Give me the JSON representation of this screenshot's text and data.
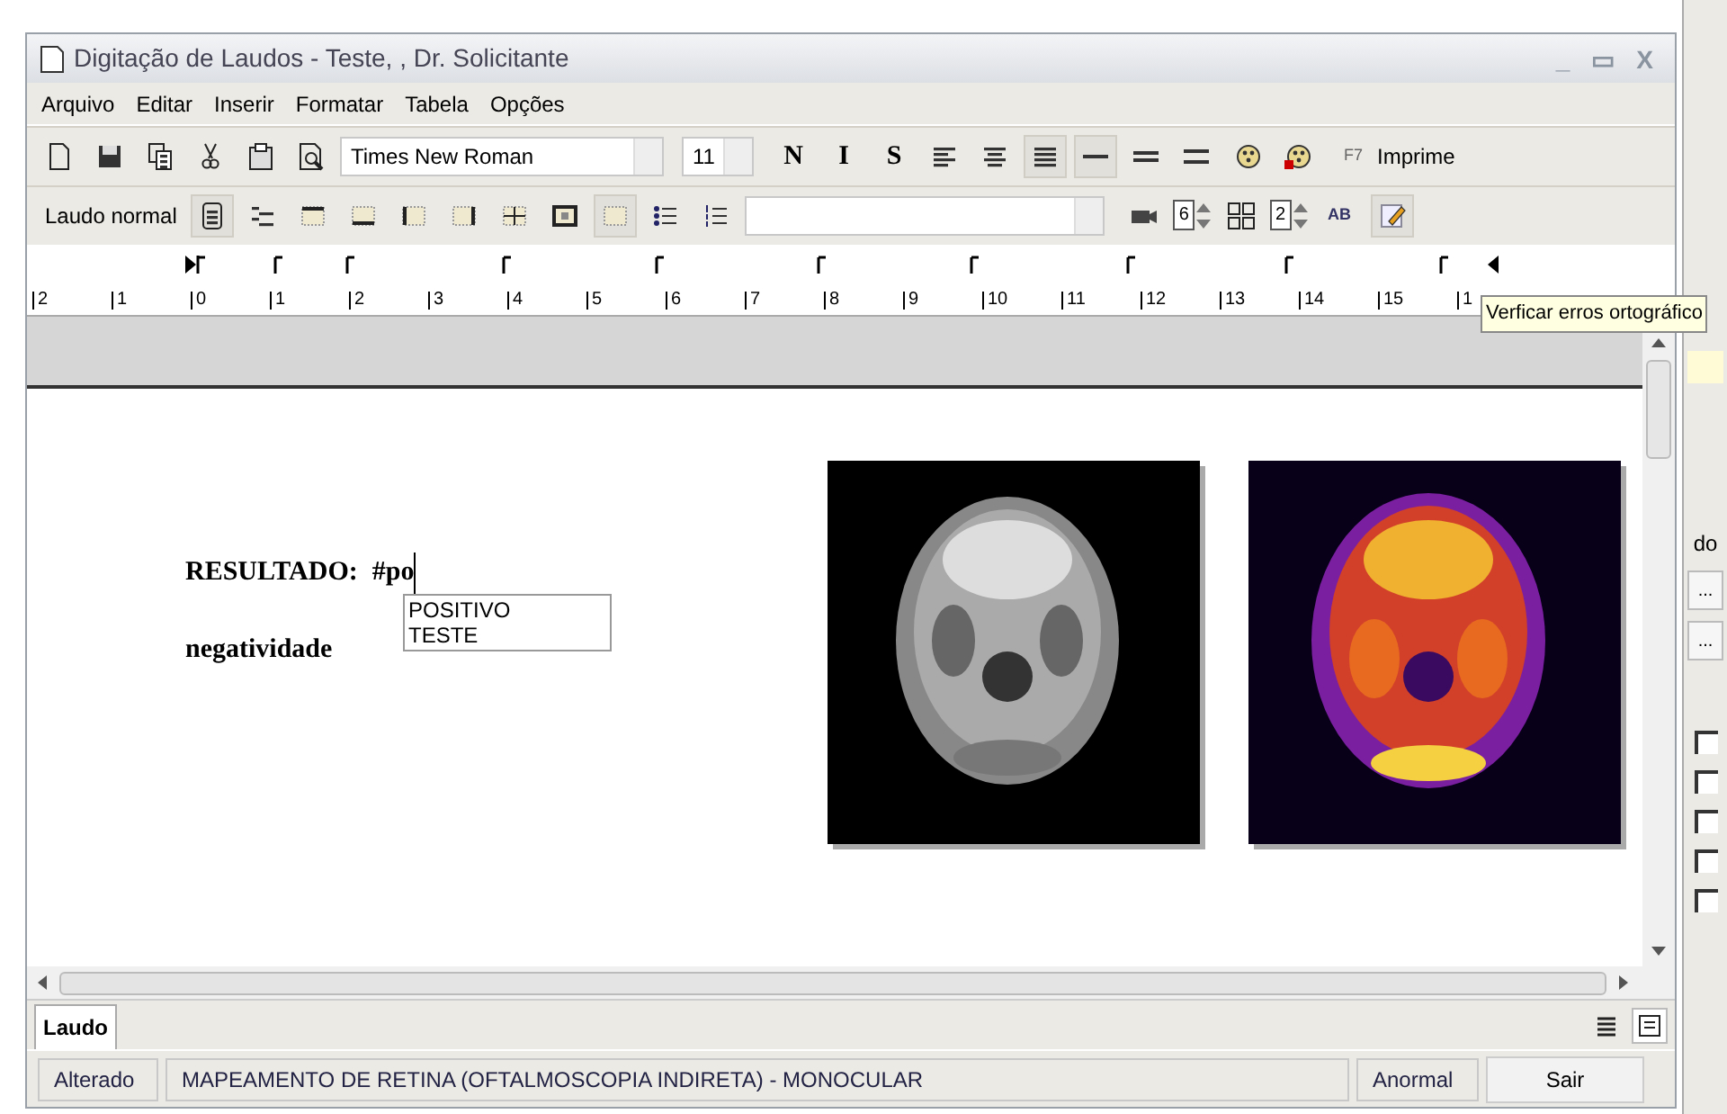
{
  "window": {
    "title": "Digitação de Laudos - Teste, , Dr. Solicitante",
    "controls": [
      "_",
      "▭",
      "X"
    ]
  },
  "menu": [
    "Arquivo",
    "Editar",
    "Inserir",
    "Formatar",
    "Tabela",
    "Opções"
  ],
  "toolbar": [
    {
      "kind": "icon",
      "pressed": false
    },
    {
      "kind": "icon",
      "pressed": false
    },
    {
      "kind": "icon",
      "pressed": false
    },
    {
      "kind": "icon",
      "pressed": false
    },
    {
      "kind": "icon",
      "pressed": false
    },
    {
      "kind": "icon",
      "pressed": false
    },
    {
      "kind": "combo",
      "value": "Times New Roman"
    },
    {
      "kind": "combo",
      "value": "11"
    },
    {
      "kind": "glyph",
      "text": "N",
      "pressed": false
    },
    {
      "kind": "glyph",
      "text": "I",
      "pressed": false
    },
    {
      "kind": "glyph",
      "text": "S",
      "pressed": false
    },
    {
      "kind": "icon",
      "pressed": false
    },
    {
      "kind": "icon",
      "pressed": false
    },
    {
      "kind": "icon",
      "pressed": true
    },
    {
      "kind": "icon",
      "pressed": true
    },
    {
      "kind": "icon",
      "pressed": false
    },
    {
      "kind": "icon",
      "pressed": false
    },
    {
      "kind": "icon",
      "pressed": false
    },
    {
      "kind": "icon",
      "pressed": false
    },
    {
      "kind": "hint",
      "text": "F7"
    },
    {
      "kind": "button",
      "text": "Imprime"
    }
  ],
  "toolbar_2": [
    {
      "kind": "button",
      "text": "Laudo normal"
    },
    {
      "kind": "icon",
      "pressed": true
    },
    {
      "kind": "icon",
      "pressed": false
    },
    {
      "kind": "icon",
      "pressed": false
    },
    {
      "kind": "icon",
      "pressed": false
    },
    {
      "kind": "icon",
      "pressed": false
    },
    {
      "kind": "icon",
      "pressed": false
    },
    {
      "kind": "icon",
      "pressed": false
    },
    {
      "kind": "icon",
      "pressed": false
    },
    {
      "kind": "icon",
      "pressed": true
    },
    {
      "kind": "icon",
      "pressed": false
    },
    {
      "kind": "icon",
      "pressed": false
    },
    {
      "kind": "combo"
    },
    {
      "kind": "icon",
      "pressed": false
    },
    {
      "kind": "spinner",
      "text": "6"
    },
    {
      "kind": "icon",
      "pressed": false
    },
    {
      "kind": "spinner",
      "text": "2"
    },
    {
      "kind": "spell",
      "text": "AB"
    },
    {
      "kind": "icon",
      "pressed": true
    }
  ],
  "ruler": [
    "2",
    "1",
    "0",
    "1",
    "2",
    "3",
    "4",
    "5",
    "6",
    "7",
    "8",
    "9",
    "10",
    "11",
    "12",
    "13",
    "14",
    "15",
    "1"
  ],
  "tooltip": "Verficar erros ortográfico",
  "document": {
    "label": "RESULTADO:",
    "typed": "#po",
    "second_line": "negatividade",
    "autocomplete": [
      {
        "text": "POSITIVO",
        "selected": false
      },
      {
        "text": "TESTE",
        "selected": false
      }
    ]
  },
  "tabs": [
    {
      "label": "Laudo",
      "selected": true
    }
  ],
  "view_buttons": [
    {
      "pressed": false
    },
    {
      "pressed": true
    }
  ],
  "status_bar": {
    "state": "Alterado",
    "exam": "MAPEAMENTO DE RETINA (OFTALMOSCOPIA INDIRETA) - MONOCULAR",
    "result": "Anormal",
    "exit_button": "Sair"
  },
  "background_window": {
    "label": "do",
    "buttons": [
      "...",
      "..."
    ],
    "checkboxes": [
      {
        "checked": false
      },
      {
        "checked": false
      },
      {
        "checked": false
      },
      {
        "checked": false
      },
      {
        "checked": false
      }
    ]
  }
}
